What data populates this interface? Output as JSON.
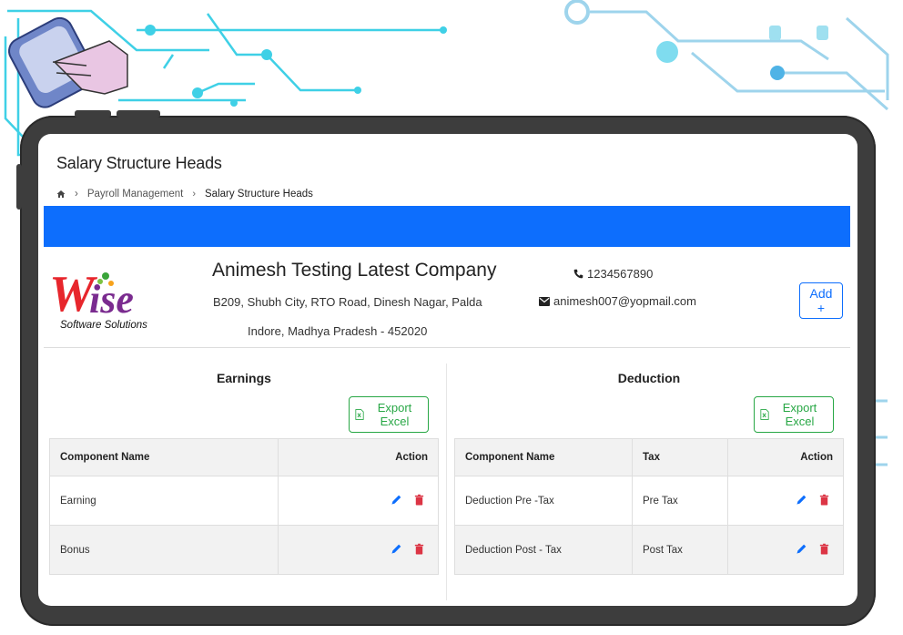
{
  "page": {
    "title": "Salary Structure Heads",
    "breadcrumb": [
      "Payroll Management",
      "Salary Structure Heads"
    ]
  },
  "company": {
    "logo_text": "Wise",
    "logo_subtitle": "Software Solutions",
    "name": "Animesh Testing Latest Company",
    "address_line1": "B209, Shubh City, RTO Road, Dinesh Nagar, Palda",
    "address_line2": "Indore, Madhya Pradesh - 452020",
    "phone": "1234567890",
    "email": "animesh007@yopmail.com",
    "add_label": "Add +"
  },
  "earnings": {
    "title": "Earnings",
    "export_label": "Export Excel",
    "columns": [
      "Component Name",
      "Action"
    ],
    "rows": [
      {
        "name": "Earning"
      },
      {
        "name": "Bonus"
      }
    ]
  },
  "deduction": {
    "title": "Deduction",
    "export_label": "Export Excel",
    "columns": [
      "Component Name",
      "Tax",
      "Action"
    ],
    "rows": [
      {
        "name": "Deduction Pre -Tax",
        "tax": "Pre Tax"
      },
      {
        "name": "Deduction Post - Tax",
        "tax": "Post Tax"
      }
    ]
  },
  "colors": {
    "primary": "#0d6efd",
    "export": "#28a745",
    "delete": "#dc3545",
    "circuit": "#3fd0e6"
  },
  "icons": [
    "home-icon",
    "chevron-right-icon",
    "phone-icon",
    "envelope-icon",
    "excel-icon",
    "pencil-icon",
    "trash-icon"
  ]
}
